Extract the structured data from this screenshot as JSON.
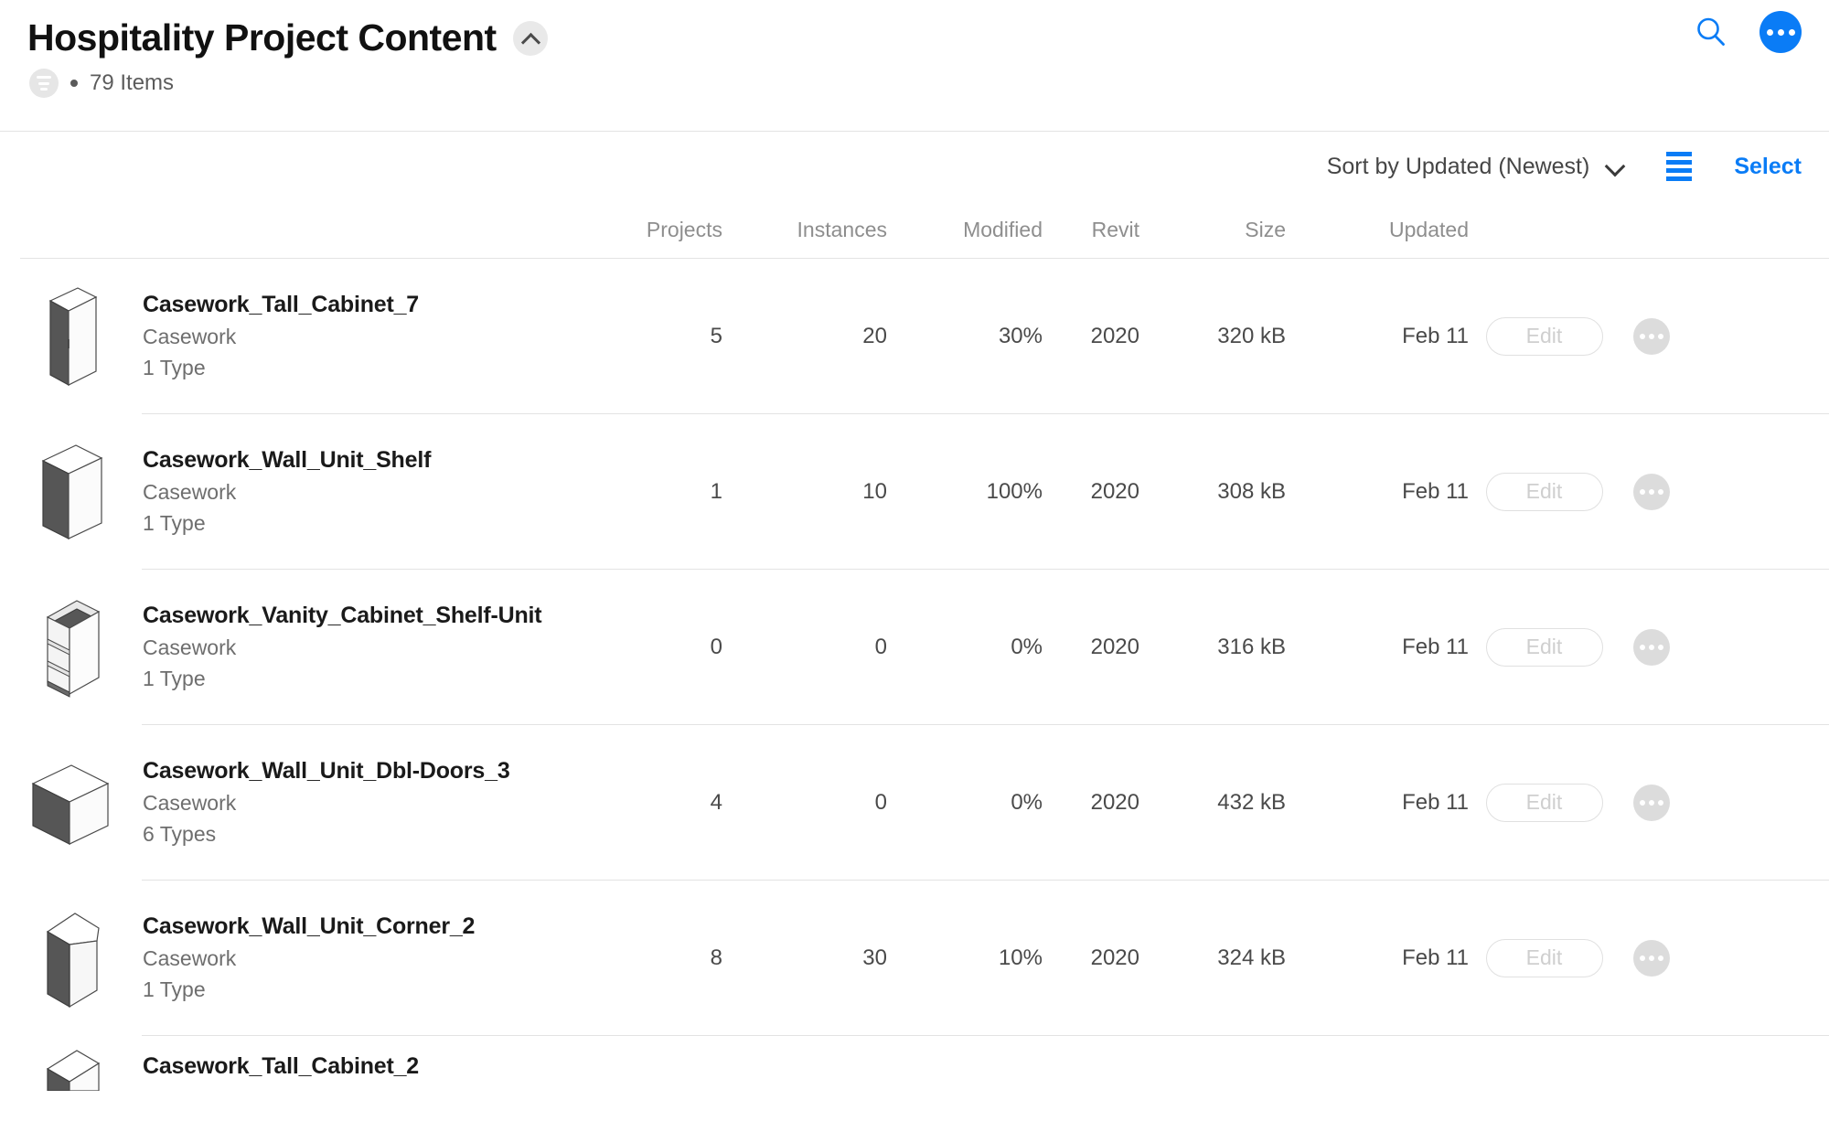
{
  "header": {
    "title": "Hospitality Project Content",
    "collapse_icon": "chevron-up-icon",
    "filter_icon": "filter-icon",
    "item_count": "79 Items",
    "search_icon": "search-icon",
    "more_icon": "more-horizontal-icon",
    "accent_color": "#0a7cf6"
  },
  "toolbar": {
    "sort_label": "Sort by Updated (Newest)",
    "sort_chevron": "chevron-down-icon",
    "view_icon": "list-view-icon",
    "select_label": "Select"
  },
  "columns": {
    "name": "",
    "projects": "Projects",
    "instances": "Instances",
    "modified": "Modified",
    "revit": "Revit",
    "size": "Size",
    "updated": "Updated"
  },
  "rows": [
    {
      "title": "Casework_Tall_Cabinet_7",
      "category": "Casework",
      "types": "1 Type",
      "projects": "5",
      "instances": "20",
      "modified": "30%",
      "revit": "2020",
      "size": "320 kB",
      "updated": "Feb 11",
      "edit_label": "Edit",
      "thumb": "tall-cabinet-thumbnail"
    },
    {
      "title": "Casework_Wall_Unit_Shelf",
      "category": "Casework",
      "types": "1 Type",
      "projects": "1",
      "instances": "10",
      "modified": "100%",
      "revit": "2020",
      "size": "308 kB",
      "updated": "Feb 11",
      "edit_label": "Edit",
      "thumb": "wall-unit-shelf-thumbnail"
    },
    {
      "title": "Casework_Vanity_Cabinet_Shelf-Unit",
      "category": "Casework",
      "types": "1 Type",
      "projects": "0",
      "instances": "0",
      "modified": "0%",
      "revit": "2020",
      "size": "316 kB",
      "updated": "Feb 11",
      "edit_label": "Edit",
      "thumb": "vanity-shelf-unit-thumbnail"
    },
    {
      "title": "Casework_Wall_Unit_Dbl-Doors_3",
      "category": "Casework",
      "types": "6 Types",
      "projects": "4",
      "instances": "0",
      "modified": "0%",
      "revit": "2020",
      "size": "432 kB",
      "updated": "Feb 11",
      "edit_label": "Edit",
      "thumb": "wall-unit-dbl-doors-thumbnail"
    },
    {
      "title": "Casework_Wall_Unit_Corner_2",
      "category": "Casework",
      "types": "1 Type",
      "projects": "8",
      "instances": "30",
      "modified": "10%",
      "revit": "2020",
      "size": "324 kB",
      "updated": "Feb 11",
      "edit_label": "Edit",
      "thumb": "wall-unit-corner-thumbnail"
    },
    {
      "title": "Casework_Tall_Cabinet_2",
      "category": "",
      "types": "",
      "projects": "",
      "instances": "",
      "modified": "",
      "revit": "",
      "size": "",
      "updated": "",
      "edit_label": "",
      "thumb": "tall-cabinet-2-thumbnail"
    }
  ]
}
